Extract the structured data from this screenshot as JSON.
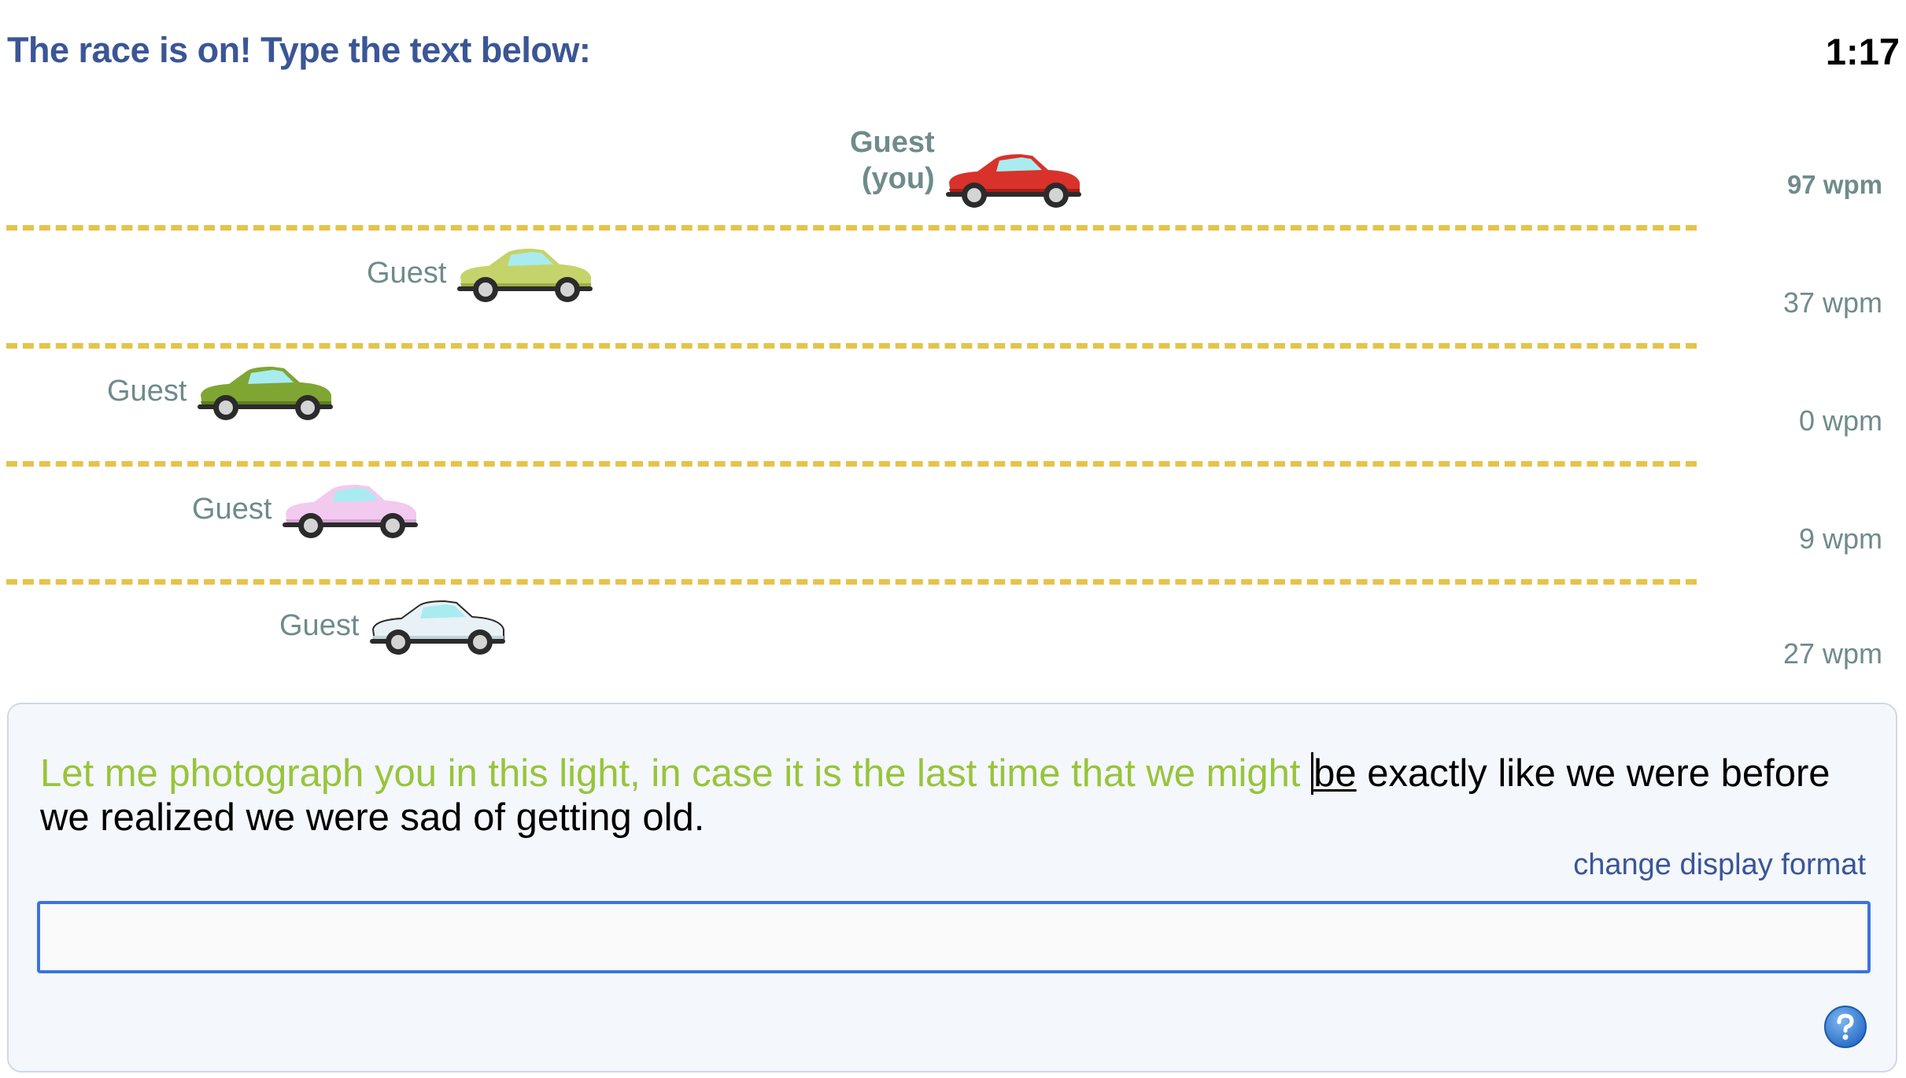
{
  "header": {
    "title": "The race is on! Type the text below:",
    "timer": "1:17"
  },
  "racers": [
    {
      "name": "Guest",
      "name_line2": "(you)",
      "is_you": true,
      "wpm": "97 wpm",
      "car_color": "#d9322b"
    },
    {
      "name": "Guest",
      "name_line2": "",
      "is_you": false,
      "wpm": "37 wpm",
      "car_color": "#c4d46a"
    },
    {
      "name": "Guest",
      "name_line2": "",
      "is_you": false,
      "wpm": "0 wpm",
      "car_color": "#7fa632"
    },
    {
      "name": "Guest",
      "name_line2": "",
      "is_you": false,
      "wpm": "9 wpm",
      "car_color": "#f2c9ef"
    },
    {
      "name": "Guest",
      "name_line2": "",
      "is_you": false,
      "wpm": "27 wpm",
      "car_color": "#e8f1f5"
    }
  ],
  "passage": {
    "typed": "Let me photograph you in this light, in case it is the last time that we might ",
    "current_word": "be",
    "remaining": " exactly like we were before we realized we were sad of getting old."
  },
  "controls": {
    "change_display_format": "change display format",
    "input_value": ""
  },
  "icons": {
    "help": "help-icon"
  },
  "colors": {
    "title": "#3a5696",
    "typed_text": "#99c43a",
    "lane_divider": "#e6c34a",
    "input_border": "#3b73e0"
  }
}
